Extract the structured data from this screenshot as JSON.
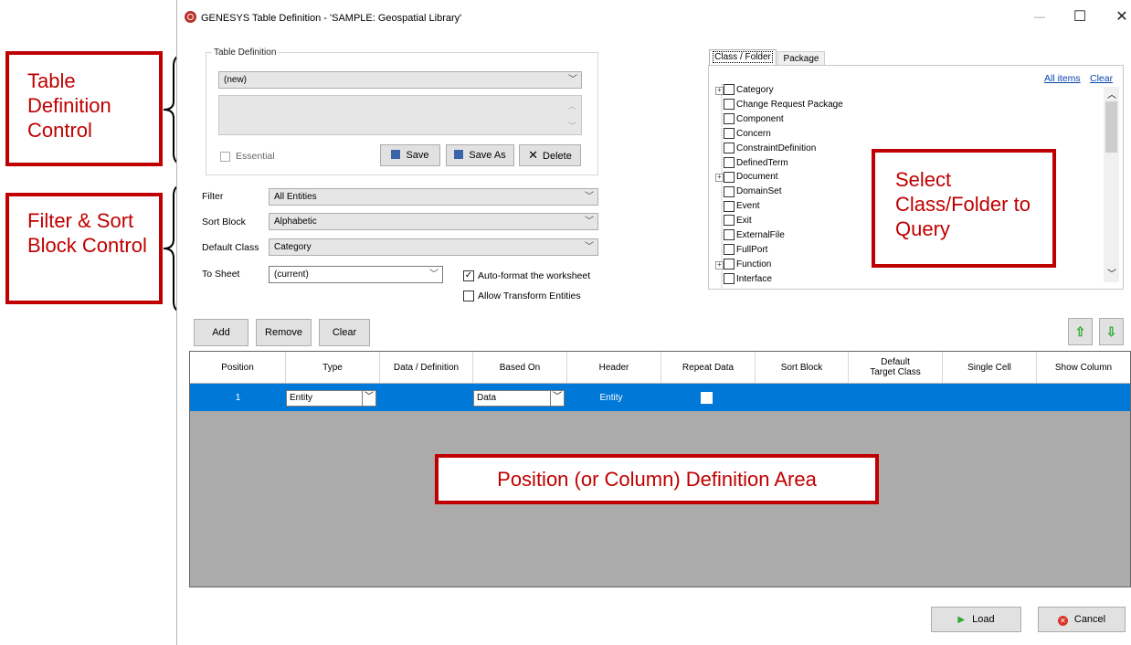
{
  "window": {
    "title": "GENESYS Table Definition - 'SAMPLE: Geospatial Library'",
    "minimize": "—",
    "maximize": "☐",
    "close": "✕"
  },
  "callouts": {
    "table_def": "Table Definition Control",
    "filter_sort": "Filter & Sort Block Control",
    "select_class": "Select Class/Folder to Query",
    "position_area": "Position (or Column) Definition Area"
  },
  "table_definition": {
    "legend": "Table Definition",
    "selected": "(new)",
    "essential_label": "Essential",
    "save": "Save",
    "save_as": "Save As",
    "delete": "Delete"
  },
  "filter": {
    "filter_label": "Filter",
    "filter_value": "All Entities",
    "sort_label": "Sort Block",
    "sort_value": "Alphabetic",
    "default_class_label": "Default Class",
    "default_class_value": "Category",
    "to_sheet_label": "To Sheet",
    "to_sheet_value": "(current)",
    "autoformat_label": "Auto-format the worksheet",
    "autoformat_checked": true,
    "allow_transform_label": "Allow Transform Entities",
    "allow_transform_checked": false
  },
  "class_panel": {
    "tabs": [
      "Class / Folder",
      "Package"
    ],
    "all_items": "All items",
    "clear": "Clear",
    "items": [
      {
        "label": "Category",
        "expandable": true
      },
      {
        "label": "Change Request Package",
        "expandable": false
      },
      {
        "label": "Component",
        "expandable": false
      },
      {
        "label": "Concern",
        "expandable": false
      },
      {
        "label": "ConstraintDefinition",
        "expandable": false
      },
      {
        "label": "DefinedTerm",
        "expandable": false
      },
      {
        "label": "Document",
        "expandable": true
      },
      {
        "label": "DomainSet",
        "expandable": false
      },
      {
        "label": "Event",
        "expandable": false
      },
      {
        "label": "Exit",
        "expandable": false
      },
      {
        "label": "ExternalFile",
        "expandable": false
      },
      {
        "label": "FullPort",
        "expandable": false
      },
      {
        "label": "Function",
        "expandable": true
      },
      {
        "label": "Interface",
        "expandable": false
      }
    ]
  },
  "toolbar": {
    "add": "Add",
    "remove": "Remove",
    "clear": "Clear"
  },
  "grid": {
    "headers": [
      "Position",
      "Type",
      "Data / Definition",
      "Based On",
      "Header",
      "Repeat Data",
      "Sort Block",
      "Default Target Class",
      "Single Cell",
      "Show Column"
    ],
    "rows": [
      {
        "position": "1",
        "type": "Entity",
        "data_definition": "",
        "based_on": "Data",
        "header": "Entity",
        "repeat_data": false
      }
    ]
  },
  "footer": {
    "load": "Load",
    "cancel": "Cancel"
  },
  "colors": {
    "accent": "#c00000",
    "selection": "#0078d7",
    "grid_bg": "#ababab"
  }
}
